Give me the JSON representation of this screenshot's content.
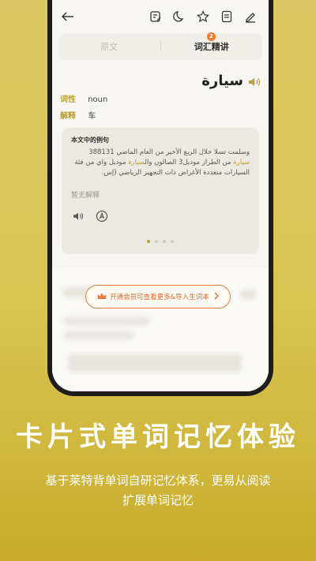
{
  "colors": {
    "accent": "#b9a030",
    "vip": "#e9783f",
    "background": "#d9c451"
  },
  "toolbar": {
    "icons": [
      "back-arrow-icon",
      "note-edit-icon",
      "moon-icon",
      "star-icon",
      "list-icon",
      "pen-icon"
    ]
  },
  "tabs": [
    {
      "label": "原文",
      "active": false
    },
    {
      "label": "词汇精讲",
      "active": true,
      "badge": "2"
    }
  ],
  "word": {
    "text": "سيارة",
    "pos_label": "词性",
    "pos_value": "noun",
    "def_label": "解释",
    "def_value": "车"
  },
  "example_card": {
    "title": "本文中的例句",
    "sentence_before": "وسلمت تسلا خلال الربع الأخير من العام الماضي 388131 ",
    "sentence_hl1": "سيارة",
    "sentence_mid": " من الطراز موديل3 الصالون وال",
    "sentence_hl2": "سيارة",
    "sentence_after": " موديل واي من فئة السيارات متعددة الأغراض ذات التجهيز الرياضي (إس.",
    "no_explanation": "暂无解释",
    "pagination": {
      "total": 4,
      "current": 1
    }
  },
  "vip_button": {
    "label": "开通会员可查看更多&导入生词本"
  },
  "promo": {
    "headline": "卡片式单词记忆体验",
    "subline": "基于莱特背单词自研记忆体系，更易从阅读扩展单词记忆"
  }
}
